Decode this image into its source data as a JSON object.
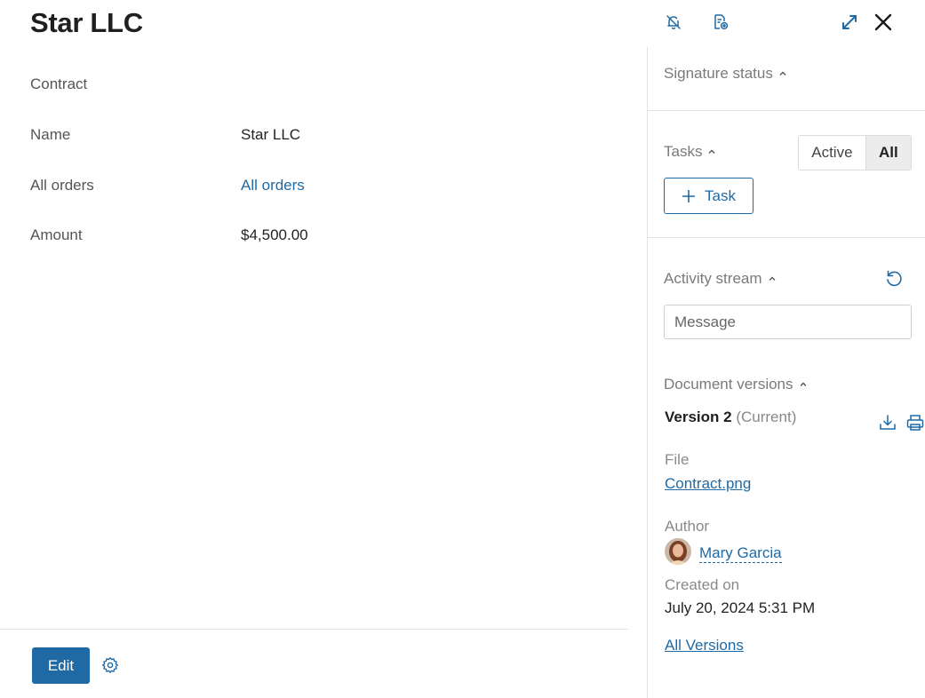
{
  "header": {
    "title": "Star LLC",
    "icons": [
      "bell-off-icon",
      "document-settings-icon",
      "expand-icon",
      "close-icon"
    ]
  },
  "form": {
    "section_label": "Contract",
    "fields": [
      {
        "label": "Name",
        "value": "Star LLC"
      },
      {
        "label": "All orders",
        "value": "All orders"
      },
      {
        "label": "Amount",
        "value": "$4,500.00"
      }
    ]
  },
  "footer": {
    "edit_label": "Edit"
  },
  "sidebar": {
    "signature_status": "Signature status",
    "tasks": {
      "title": "Tasks",
      "toggle_active": "Active",
      "toggle_all": "All",
      "add_task_label": "Task"
    },
    "activity_stream": {
      "title": "Activity stream",
      "message_placeholder": "Message"
    },
    "document_versions": {
      "title": "Document versions",
      "version_label": "Version 2",
      "version_status": "(Current)",
      "file_label": "File",
      "file_name": "Contract.png",
      "author_label": "Author",
      "author_name": "Mary Garcia",
      "created_label": "Created on",
      "created_value": "July 20, 2024 5:31 PM",
      "all_versions_label": "All Versions"
    }
  },
  "colors": {
    "accent": "#1f6aa5",
    "muted_text": "#7a7a7a",
    "divider": "#e2e2e2"
  }
}
